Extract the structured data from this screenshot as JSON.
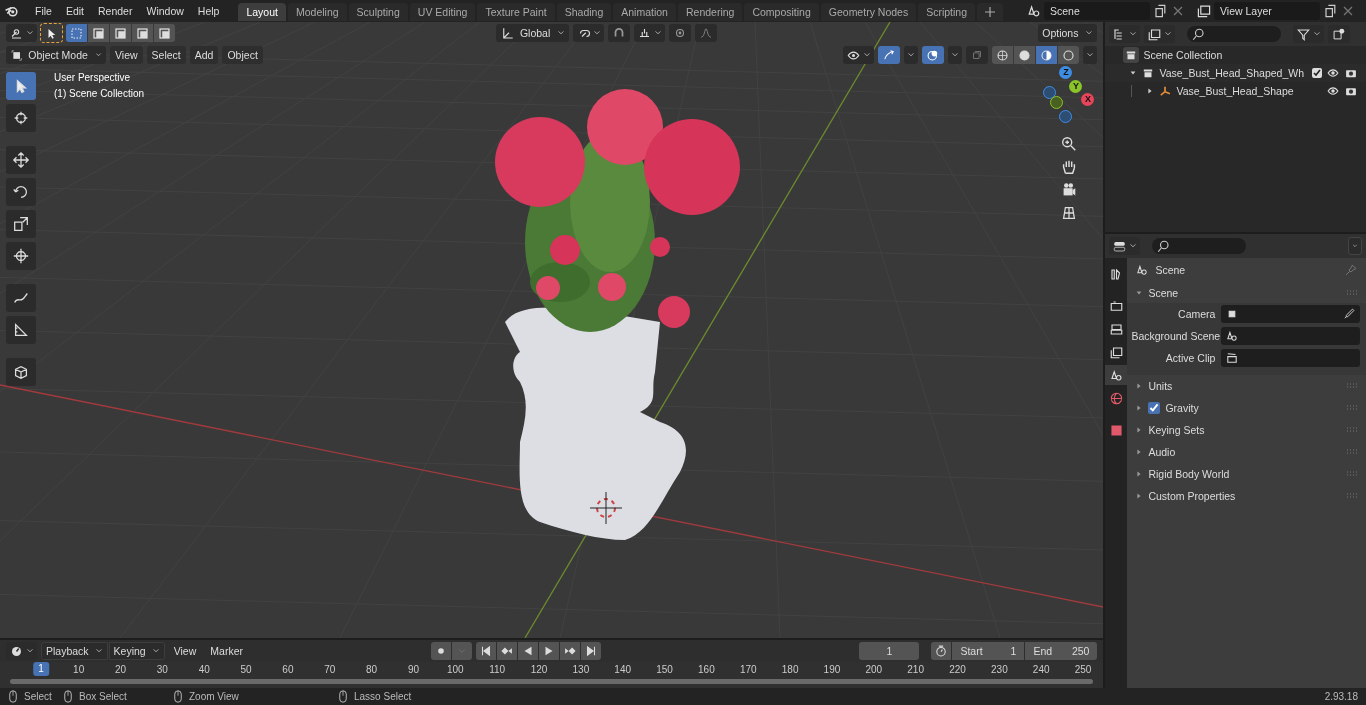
{
  "menu_bar": {
    "items": [
      "File",
      "Edit",
      "Render",
      "Window",
      "Help"
    ]
  },
  "workspace_tabs": [
    {
      "label": "Layout",
      "selected": true
    },
    {
      "label": "Modeling",
      "selected": false
    },
    {
      "label": "Sculpting",
      "selected": false
    },
    {
      "label": "UV Editing",
      "selected": false
    },
    {
      "label": "Texture Paint",
      "selected": false
    },
    {
      "label": "Shading",
      "selected": false
    },
    {
      "label": "Animation",
      "selected": false
    },
    {
      "label": "Rendering",
      "selected": false
    },
    {
      "label": "Compositing",
      "selected": false
    },
    {
      "label": "Geometry Nodes",
      "selected": false
    },
    {
      "label": "Scripting",
      "selected": false
    }
  ],
  "scene_selector": {
    "value": "Scene"
  },
  "view_layer_selector": {
    "value": "View Layer"
  },
  "viewport": {
    "select_modes": [
      {
        "selected": true
      },
      {
        "selected": false
      },
      {
        "selected": false
      },
      {
        "selected": false
      },
      {
        "selected": false
      }
    ],
    "transform_orientation": "Global",
    "options_label": "Options",
    "mode": "Object Mode",
    "menus": [
      "View",
      "Select",
      "Add",
      "Object"
    ],
    "shading_modes": [
      {
        "selected": false
      },
      {
        "selected": false
      },
      {
        "selected": true
      },
      {
        "selected": false
      }
    ],
    "overlay_text": [
      "User Perspective",
      "(1) Scene Collection"
    ],
    "gizmo_axes": [
      "X",
      "Y",
      "Z"
    ],
    "tools": [
      {
        "kind": "select",
        "selected": true
      },
      {
        "kind": "cursor",
        "selected": false
      },
      {
        "kind": "move",
        "selected": false
      },
      {
        "kind": "rotate",
        "selected": false
      },
      {
        "kind": "scale",
        "selected": false
      },
      {
        "kind": "transform",
        "selected": false
      },
      {
        "kind": "annotate",
        "selected": false
      },
      {
        "kind": "measure",
        "selected": false
      },
      {
        "kind": "add-cube",
        "selected": false
      }
    ]
  },
  "outliner": {
    "root": "Scene Collection",
    "items": [
      {
        "label": "Vase_Bust_Head_Shaped_Wh",
        "kind": "collection",
        "expanded": true,
        "checked": true,
        "children": [
          {
            "label": "Vase_Bust_Head_Shape",
            "kind": "empty",
            "expanded": false
          }
        ]
      }
    ]
  },
  "properties": {
    "tabs": [
      {
        "kind": "tool",
        "selected": false
      },
      {
        "kind": "render",
        "selected": false
      },
      {
        "kind": "output",
        "selected": false
      },
      {
        "kind": "view-layer",
        "selected": false
      },
      {
        "kind": "scene",
        "selected": true
      },
      {
        "kind": "world",
        "selected": false
      },
      {
        "kind": "texture",
        "selected": false
      }
    ],
    "context": "Scene",
    "panels": [
      {
        "title": "Scene",
        "expanded": true,
        "fields": [
          "Camera",
          "Background Scene",
          "Active Clip"
        ]
      },
      {
        "title": "Units",
        "expanded": false
      },
      {
        "title": "Gravity",
        "expanded": false,
        "checked": true
      },
      {
        "title": "Keying Sets",
        "expanded": false
      },
      {
        "title": "Audio",
        "expanded": false
      },
      {
        "title": "Rigid Body World",
        "expanded": false
      },
      {
        "title": "Custom Properties",
        "expanded": false
      }
    ]
  },
  "timeline": {
    "menus": [
      "Playback",
      "Keying",
      "View",
      "Marker"
    ],
    "current_frame": "1",
    "start_label": "Start",
    "start": "1",
    "end_label": "End",
    "end": "250",
    "ruler": [
      "1",
      "10",
      "20",
      "30",
      "40",
      "50",
      "60",
      "70",
      "80",
      "90",
      "100",
      "110",
      "120",
      "130",
      "140",
      "150",
      "160",
      "170",
      "180",
      "190",
      "200",
      "210",
      "220",
      "230",
      "240",
      "250"
    ]
  },
  "status_bar": {
    "items": [
      "Select",
      "Box Select",
      "Zoom View",
      "Lasso Select"
    ],
    "version": "2.93.18"
  }
}
